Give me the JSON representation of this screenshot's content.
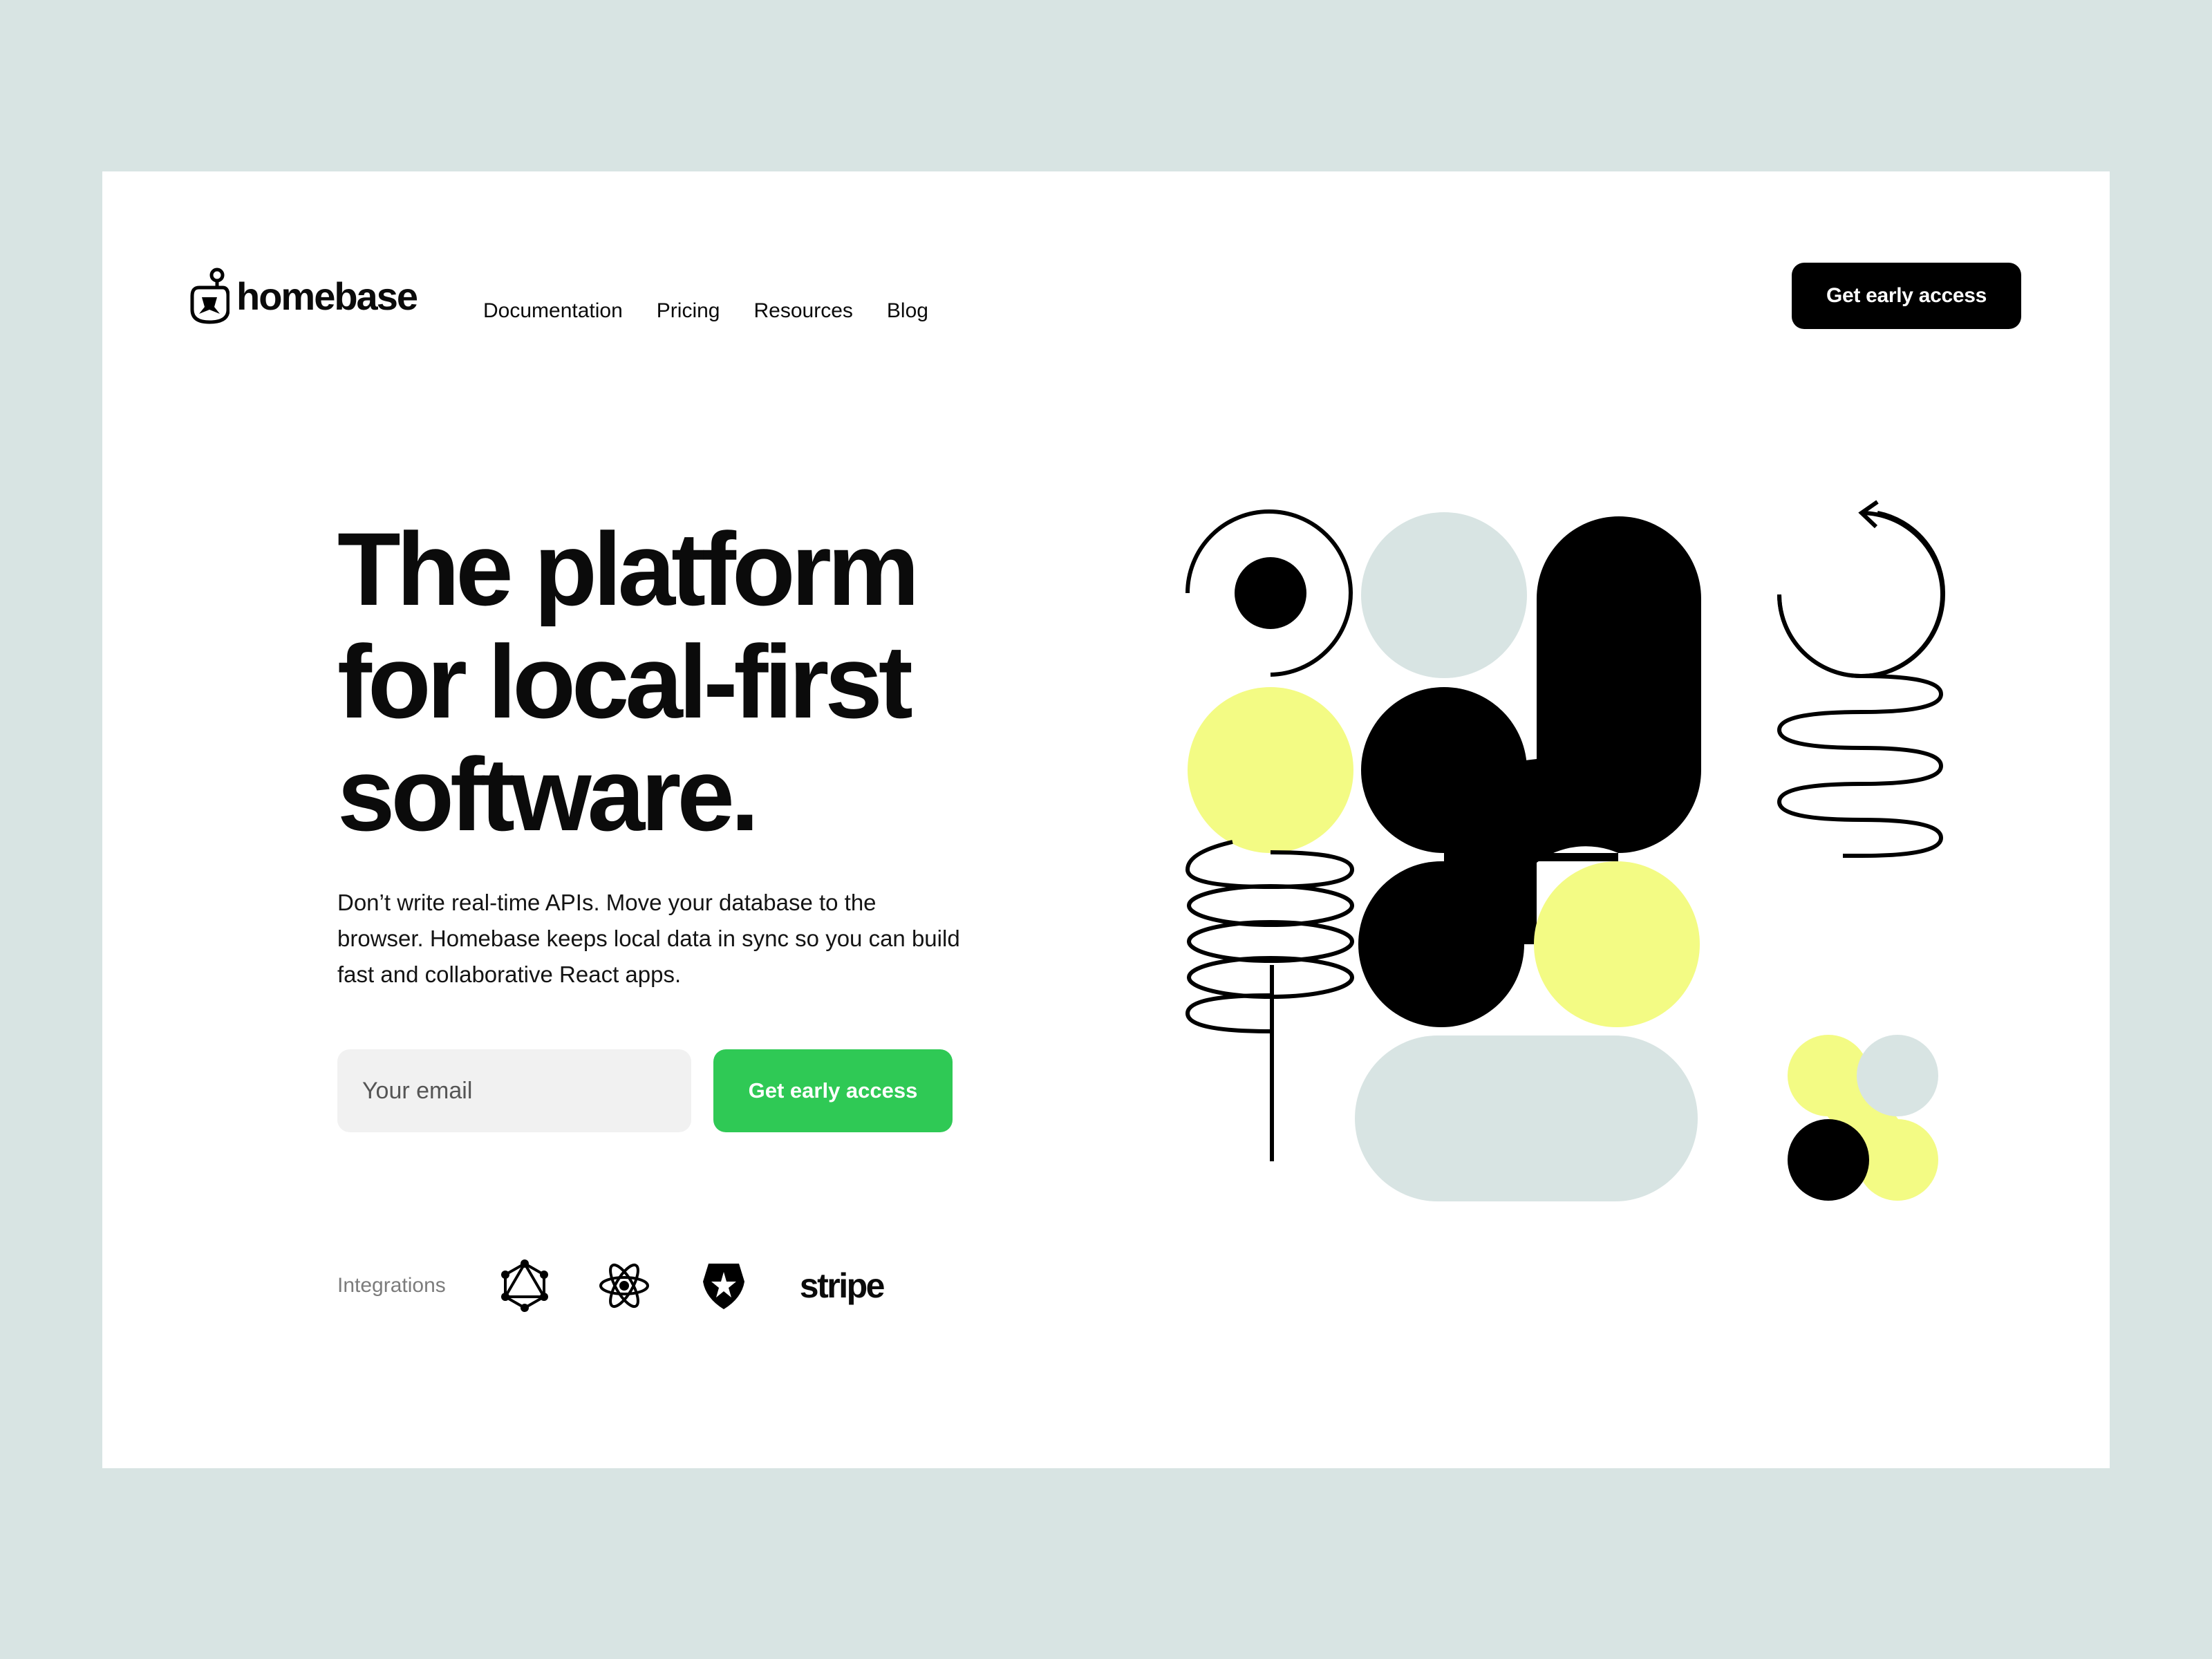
{
  "brand": {
    "name": "homebase"
  },
  "nav": {
    "items": [
      {
        "label": "Documentation"
      },
      {
        "label": "Pricing"
      },
      {
        "label": "Resources"
      },
      {
        "label": "Blog"
      }
    ]
  },
  "header": {
    "cta_label": "Get early access"
  },
  "hero": {
    "headline_lines": [
      "The platform",
      "for local-first",
      "software."
    ],
    "subtext": "Don’t write real-time APIs. Move your database to the browser. Homebase keeps local data in sync so you can build fast and collaborative React apps.",
    "email_placeholder": "Your email",
    "cta_label": "Get early access"
  },
  "integrations": {
    "label": "Integrations",
    "items": [
      {
        "icon": "graphql-icon"
      },
      {
        "icon": "react-icon"
      },
      {
        "icon": "auth0-icon"
      },
      {
        "text": "stripe",
        "icon": "stripe-logo"
      }
    ]
  },
  "colors": {
    "page_background": "#d8e4e3",
    "card": "#ffffff",
    "accent_green": "#2fc955",
    "ink": "#000000",
    "illustration_yellow": "#f3fb84",
    "illustration_grey": "#d8e4e3",
    "input_background": "#f1f1f1"
  }
}
